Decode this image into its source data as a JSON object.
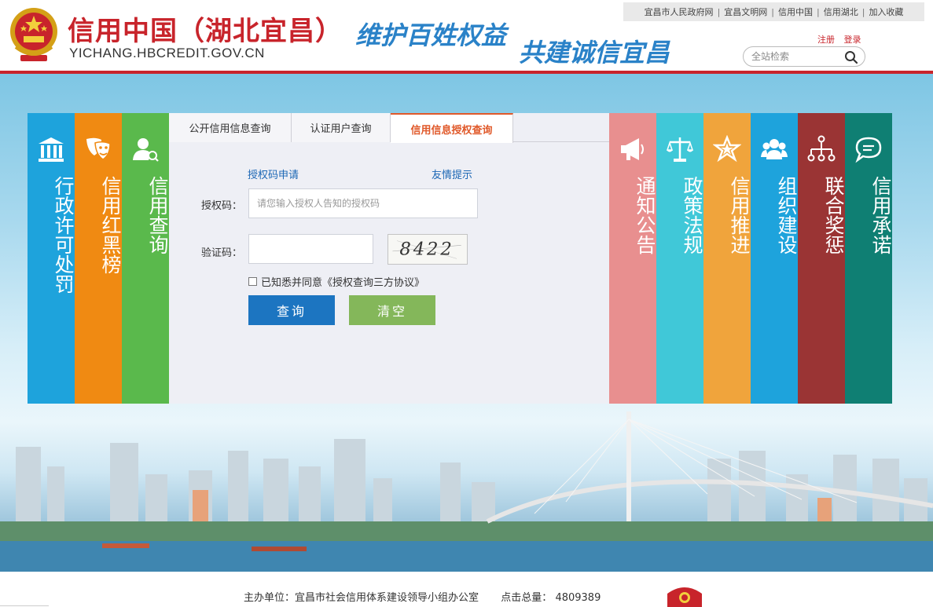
{
  "header": {
    "title": "信用中国（湖北宜昌）",
    "domain": "YICHANG.HBCREDIT.GOV.CN",
    "slogan_left": "维护百姓权益",
    "slogan_right": "共建诚信宜昌",
    "emblem_icon": "national-emblem-icon",
    "top_links": [
      "宜昌市人民政府网",
      "宜昌文明网",
      "信用中国",
      "信用湖北",
      "加入收藏"
    ],
    "register_label": "注册",
    "login_label": "登录",
    "search_placeholder": "全站检索",
    "search_icon": "search-icon"
  },
  "left_tiles": [
    {
      "label": "行政许可处罚",
      "icon": "courthouse-icon",
      "color": "#1ea3dc"
    },
    {
      "label": "信用红黑榜",
      "icon": "theater-masks-icon",
      "color": "#f08a12"
    },
    {
      "label": "信用查询",
      "icon": "user-search-icon",
      "color": "#5ab94c"
    }
  ],
  "right_tiles": [
    {
      "label": "通知公告",
      "icon": "megaphone-icon",
      "color": "#e88f8f"
    },
    {
      "label": "政策法规",
      "icon": "scales-icon",
      "color": "#40c8d8"
    },
    {
      "label": "信用推进",
      "icon": "star-icon",
      "color": "#f0a43c"
    },
    {
      "label": "组织建设",
      "icon": "people-icon",
      "color": "#1ea3dc"
    },
    {
      "label": "联合奖惩",
      "icon": "org-chart-icon",
      "color": "#9a3434"
    },
    {
      "label": "信用承诺",
      "icon": "speech-bubble-icon",
      "color": "#0f7f73"
    }
  ],
  "tabs": [
    {
      "label": "公开信用信息查询",
      "active": false
    },
    {
      "label": "认证用户查询",
      "active": false
    },
    {
      "label": "信用信息授权查询",
      "active": true
    }
  ],
  "form": {
    "apply_link": "授权码申请",
    "tips_link": "友情提示",
    "auth_code_label": "授权码：",
    "auth_code_placeholder": "请您输入授权人告知的授权码",
    "auth_code_value": "",
    "verify_label": "验证码：",
    "verify_value": "",
    "captcha_text": "8422",
    "agree_text": "已知悉并同意《授权查询三方协议》",
    "agree_checked": false,
    "query_button": "查询",
    "clear_button": "清空"
  },
  "footer": {
    "host_label": "主办单位：宜昌市社会信用体系建设领导小组办公室",
    "visits_label": "点击总量：",
    "visits_value": "4809389"
  },
  "colors": {
    "brand_red": "#c8242b",
    "slogan_blue": "#2a82c8",
    "tab_active": "#e0592a",
    "link_blue": "#1c67b5"
  }
}
